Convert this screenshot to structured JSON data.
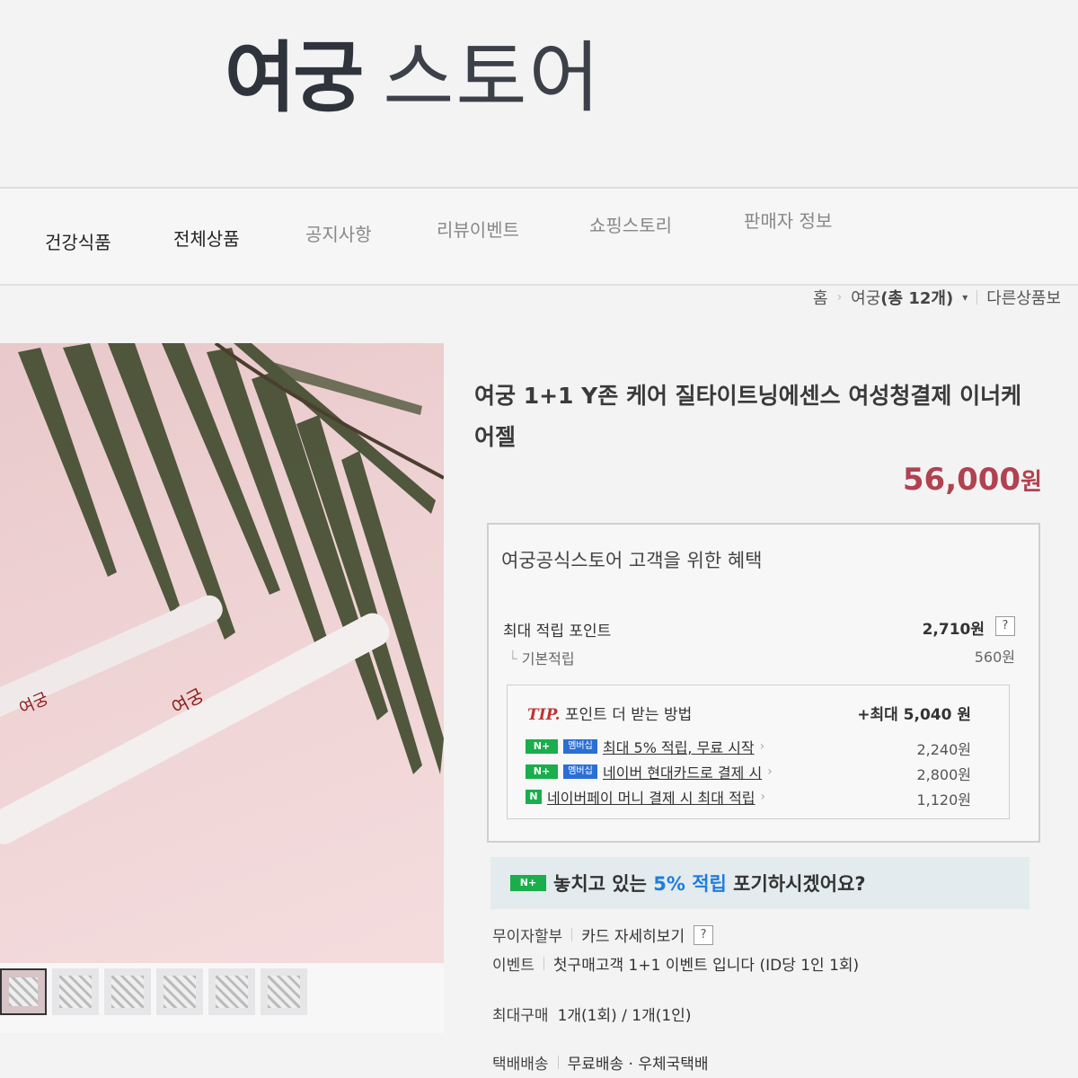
{
  "header": {
    "brand_name": "여궁",
    "brand_suffix": "스토어"
  },
  "nav": {
    "items": [
      {
        "label": "건강식품"
      },
      {
        "label": "전체상품"
      },
      {
        "label": "공지사항"
      },
      {
        "label": "리뷰이벤트"
      },
      {
        "label": "쇼핑스토리"
      },
      {
        "label": "판매자 정보"
      }
    ]
  },
  "breadcrumb": {
    "home": "홈",
    "category": "여궁",
    "count": "(총 12개)",
    "more": "다른상품보"
  },
  "product": {
    "title": "여궁 1+1 Y존 케어 질타이트닝에센스 여성청결제 이너케어젤",
    "price": "56,000",
    "price_unit": "원"
  },
  "benefit": {
    "title": "여궁공식스토어 고객을 위한 혜택",
    "max_points_label": "최대 적립 포인트",
    "max_points_value": "2,710원",
    "help": "?",
    "basic_label": "기본적립",
    "basic_value": "560원",
    "tip": {
      "tip_word": "TIP.",
      "label": "포인트 더 받는 방법",
      "max": "+최대 5,040 원",
      "rows": [
        {
          "badge": "N+",
          "badge2": "멤버십",
          "text": "최대 5% 적립, 무료 시작",
          "amount": "2,240원"
        },
        {
          "badge": "N+",
          "badge2": "멤버십",
          "text": "네이버 현대카드로 결제 시",
          "amount": "2,800원"
        },
        {
          "badge": "N",
          "text": "네이버페이 머니 결제 시 최대 적립",
          "amount": "1,120원"
        }
      ]
    }
  },
  "promo": {
    "badge": "N+",
    "text_before": "놓치고 있는 ",
    "highlight": "5% 적립",
    "text_after": " 포기하시겠어요?"
  },
  "meta": {
    "installment_label": "무이자할부",
    "card_link": "카드 자세히보기",
    "help": "?",
    "event_label": "이벤트",
    "event_text": "첫구매고객 1+1 이벤트 입니다 (ID당 1인 1회)",
    "max_purchase_label": "최대구매",
    "max_purchase_value": "1개(1회) / 1개(1인)",
    "delivery_label": "택배배송",
    "delivery_value": "무료배송 · 우체국택배"
  },
  "colors": {
    "price": "#b1424f",
    "naver_green": "#1aae4c",
    "promo_highlight": "#1f7dde"
  }
}
